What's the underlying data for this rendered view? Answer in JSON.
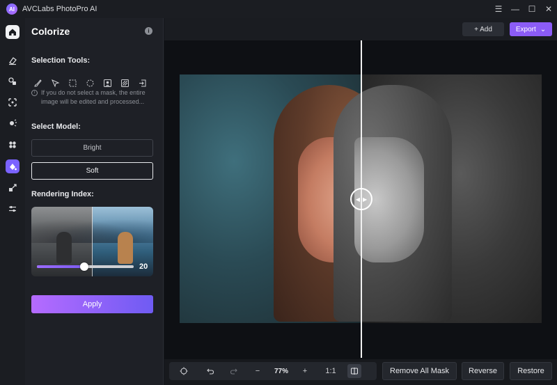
{
  "app": {
    "title": "AVCLabs PhotoPro AI",
    "logo_text": "AI"
  },
  "window_controls": [
    {
      "name": "menu-icon",
      "glyph": "☰"
    },
    {
      "name": "minimize-icon",
      "glyph": "—"
    },
    {
      "name": "maximize-icon",
      "glyph": "☐"
    },
    {
      "name": "close-icon",
      "glyph": "✕"
    }
  ],
  "panel": {
    "title": "Colorize",
    "info_glyph": "i",
    "selection_tools_label": "Selection Tools:",
    "hint_glyph": "i",
    "hint_text": "If you do not select a mask, the entire image will be edited and processed...",
    "select_model_label": "Select Model:",
    "models": [
      {
        "label": "Bright",
        "selected": false
      },
      {
        "label": "Soft",
        "selected": true
      }
    ],
    "rendering_index_label": "Rendering Index:",
    "rendering_index": {
      "value": "20",
      "fraction": 0.49
    },
    "apply_label": "Apply"
  },
  "toolbar": {
    "add_label": "+ Add",
    "export_label": "Export",
    "export_chevron": "⌄"
  },
  "compare": {
    "left_arrow": "◀",
    "right_arrow": "▶"
  },
  "view": {
    "zoom_label": "77%",
    "zoom_out_glyph": "−",
    "zoom_in_glyph": "+",
    "actual_size_label": "1:1"
  },
  "actions": {
    "remove_all_mask": "Remove All Mask",
    "reverse": "Reverse",
    "restore": "Restore"
  },
  "colors": {
    "accent": "#8b5cf6",
    "panel_bg": "#1e2026",
    "rail_bg": "#1b1d22"
  }
}
